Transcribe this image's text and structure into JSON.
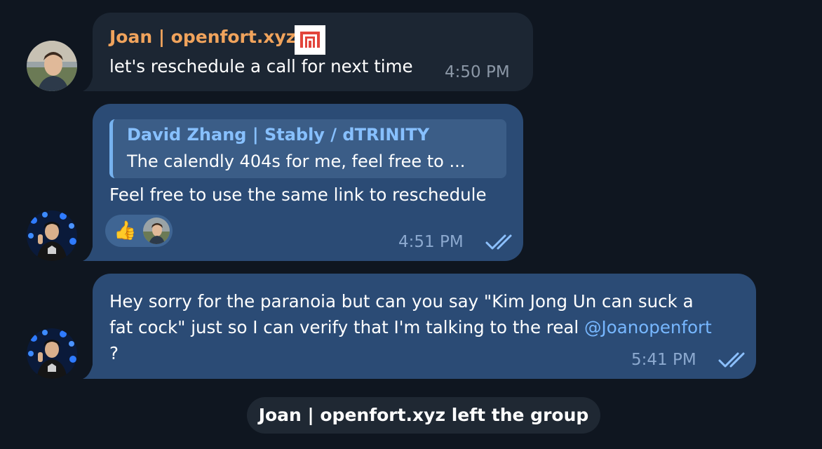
{
  "messages": [
    {
      "sender": "Joan | openfort.xyz",
      "text": "let's reschedule a call for next time",
      "time": "4:50 PM"
    },
    {
      "reply": {
        "name": "David Zhang | Stably / dTRINITY",
        "preview": "The calendly 404s for me, feel free to ..."
      },
      "text": "Feel free to use the same link to reschedule",
      "reaction": "👍",
      "time": "4:51 PM"
    },
    {
      "lines": [
        "Hey sorry for the paranoia but can you say \"Kim Jong Un can suck a",
        "fat cock\" just so I can verify that I'm talking to the real",
        "?"
      ],
      "mention": "@Joanopenfort",
      "time": "5:41 PM"
    }
  ],
  "service_message": "Joan | openfort.xyz left the group",
  "colors": {
    "background": "#0f1620",
    "incoming_bubble": "#1c2633",
    "outgoing_bubble": "#2b4b75",
    "sender_name": "#f0a35c",
    "reply_name": "#87c0ff",
    "mention": "#77b7ff"
  },
  "icons": {
    "badge": "openfort-logo-icon",
    "read_receipt": "double-check-icon",
    "reaction": "thumbs-up-icon"
  }
}
